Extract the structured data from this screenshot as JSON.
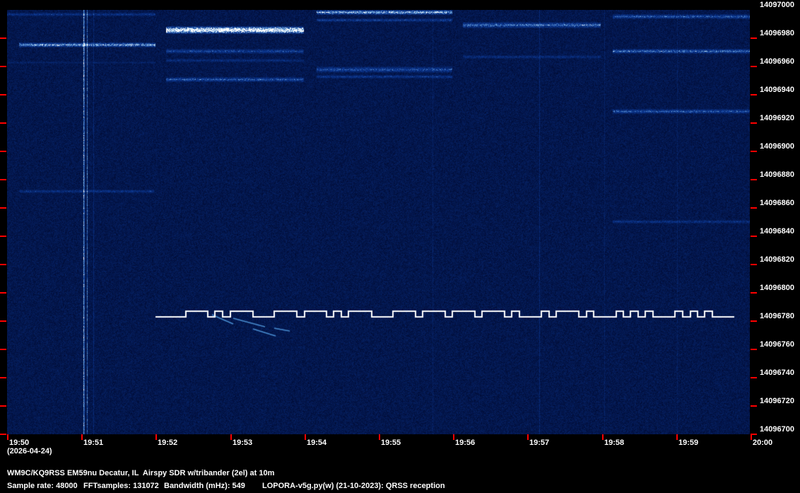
{
  "freq_axis": {
    "labels": [
      "14097000",
      "14096980",
      "14096960",
      "14096940",
      "14096920",
      "14096900",
      "14096880",
      "14096860",
      "14096840",
      "14096820",
      "14096800",
      "14096780",
      "14096760",
      "14096740",
      "14096720",
      "14096700"
    ]
  },
  "time_axis": {
    "labels": [
      "19:50",
      "19:51",
      "19:52",
      "19:53",
      "19:54",
      "19:55",
      "19:56",
      "19:57",
      "19:58",
      "19:59",
      "20:00"
    ],
    "date": "(2026-04-24)"
  },
  "footer": {
    "station": "WM9C/KQ9RSS EM59nu Decatur, IL  Airspy SDR w/tribander (2el) at 10m",
    "sample_rate": "Sample rate: 48000",
    "fft_samples": "FFTsamples: 131072",
    "bandwidth": "Bandwidth (mHz): 549",
    "software": "LOPORA-v5g.py(w) (21-10-2023): QRSS reception"
  },
  "colors": {
    "tick": "#ff0000",
    "background": "#0a1a4e",
    "signal": "#ffffff"
  }
}
